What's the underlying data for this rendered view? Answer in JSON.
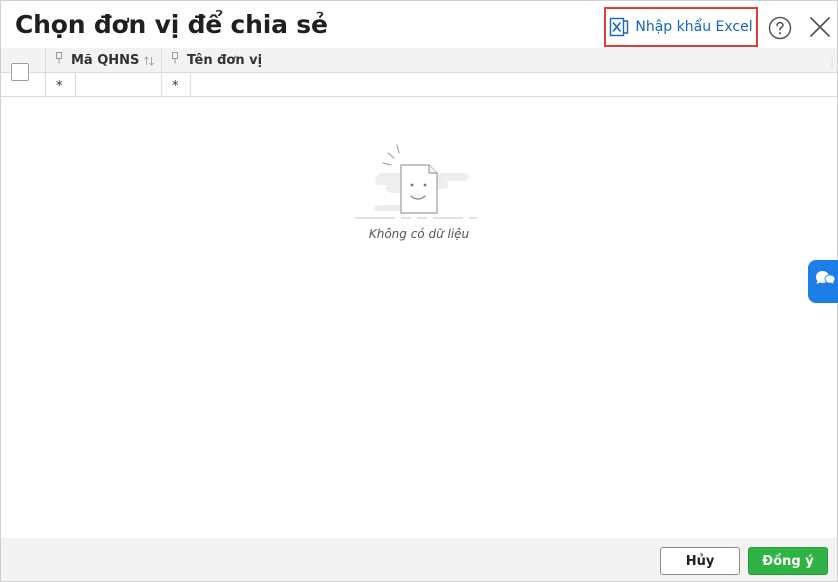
{
  "dialog": {
    "title": "Chọn đơn vị để chia sẻ"
  },
  "toolbar": {
    "import_label": "Nhập khẩu Excel",
    "import_icon": "excel-icon",
    "help_icon": "help-circle-icon",
    "close_icon": "close-icon"
  },
  "grid": {
    "columns": [
      {
        "label": "Mã QHNS",
        "filter_symbol": "*"
      },
      {
        "label": "Tên đơn vị",
        "filter_symbol": "*"
      }
    ],
    "empty_text": "Không có dữ liệu"
  },
  "footer": {
    "cancel_label": "Hủy",
    "ok_label": "Đồng ý"
  },
  "colors": {
    "accent_blue": "#1565c0",
    "highlight_red": "#e53935",
    "ok_green": "#2fb344",
    "chat_blue": "#1e7ee8"
  }
}
